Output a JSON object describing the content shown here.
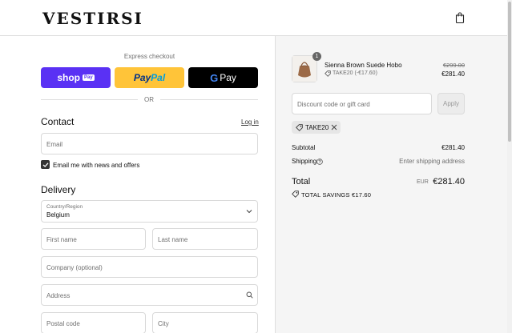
{
  "brand": {
    "logo": "VESTIRSI"
  },
  "express": {
    "label": "Express checkout",
    "shop_text": "shop",
    "shop_pay": "Pay",
    "paypal_1": "Pay",
    "paypal_2": "Pal",
    "gpay_g": "G",
    "gpay_text": "Pay",
    "or": "OR"
  },
  "contact": {
    "title": "Contact",
    "login": "Log in",
    "email_placeholder": "Email",
    "newsletter_label": "Email me with news and offers",
    "newsletter_checked": true
  },
  "delivery": {
    "title": "Delivery",
    "country_label": "Country/Region",
    "country_value": "Belgium",
    "first_name": "First name",
    "last_name": "Last name",
    "company": "Company (optional)",
    "address": "Address",
    "postal_code": "Postal code",
    "city": "City"
  },
  "summary": {
    "item": {
      "quantity": "1",
      "name": "Sienna Brown Suede Hobo",
      "discount": "TAKE20 (-€17.60)",
      "old_price": "€299.00",
      "new_price": "€281.40"
    },
    "discount_placeholder": "Discount code or gift card",
    "apply": "Apply",
    "applied_code": "TAKE20",
    "subtotal_label": "Subtotal",
    "subtotal_value": "€281.40",
    "shipping_label": "Shipping",
    "shipping_value": "Enter shipping address",
    "total_label": "Total",
    "currency": "EUR",
    "total_value": "€281.40",
    "savings_label": "TOTAL SAVINGS",
    "savings_value": "€17.60"
  },
  "colors": {
    "shop_pay": "#5a31f4",
    "paypal": "#ffc439",
    "gpay": "#000000",
    "sidebar_bg": "#f5f5f5"
  },
  "icons": [
    "shopping-bag-icon",
    "chevron-down-icon",
    "search-icon",
    "tag-icon",
    "close-icon",
    "help-icon",
    "check-icon"
  ]
}
